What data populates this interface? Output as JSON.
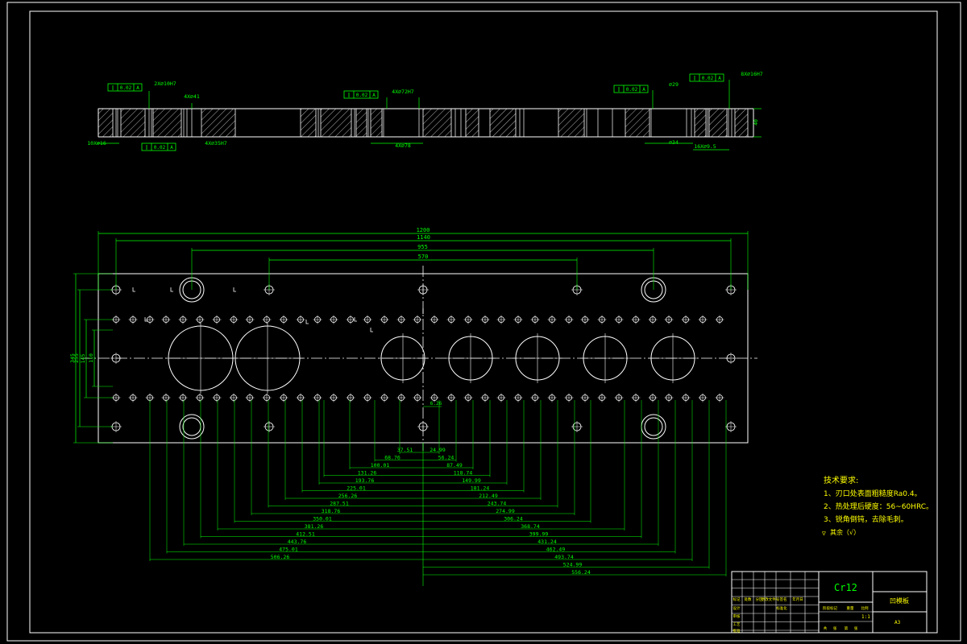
{
  "drawing": {
    "material": "Cr12",
    "part_name": "凹模板",
    "scale": "1:1",
    "sheet_label": "A3"
  },
  "tech_requirements": {
    "heading": "技术要求:",
    "items": [
      "1、刃口处表面粗糙度Ra0.4。",
      "2、热处理后硬度：56~60HRC。",
      "3、锐角倒钝，去除毛刺。"
    ],
    "roughness_note": "其余（√）"
  },
  "section_view": {
    "callouts": [
      "2X∅10H7",
      "4X∅41",
      "4X∅35H7",
      "4X∅72H7",
      "4X∅78",
      "∅29",
      "∅34",
      "8X∅16H7",
      "16X∅9.5",
      "10X∅16"
    ],
    "tolerance_frames": [
      "0.02",
      "0.02",
      "0.02",
      "0.02",
      "0.02"
    ],
    "datum_label": "A",
    "thickness": "40"
  },
  "plan_view": {
    "overall_dims": [
      "1200",
      "1140",
      "955",
      "570"
    ],
    "height_dims": [
      "345",
      "255",
      "145",
      "110"
    ],
    "small_dims": [
      "6.26"
    ],
    "left_dims": [
      "37.51",
      "68.76",
      "100.01",
      "131.26",
      "193.76",
      "225.01",
      "256.26",
      "287.51",
      "318.76",
      "350.01",
      "381.26",
      "412.51",
      "443.76",
      "475.01",
      "506.26"
    ],
    "right_dims": [
      "24.99",
      "56.24",
      "87.49",
      "118.74",
      "149.99",
      "181.24",
      "212.49",
      "243.74",
      "274.99",
      "306.24",
      "368.74",
      "399.99",
      "431.24",
      "462.49",
      "493.74",
      "524.99",
      "556.24"
    ]
  },
  "title_block": {
    "row_labels": [
      "标记",
      "处数",
      "分区",
      "更改文件号",
      "签名",
      "年月日"
    ],
    "design_row": [
      "设计",
      "标准化"
    ],
    "stage_labels": [
      "阶段标记",
      "重量",
      "比例"
    ],
    "approve_labels": [
      "审核",
      "工艺",
      "批准"
    ],
    "sheet_labels": [
      "共",
      "张",
      "第",
      "张"
    ]
  },
  "colors": {
    "line": "#ffffff",
    "dim": "#00ff00",
    "background": "#000000",
    "hatch": "#ffffff"
  }
}
